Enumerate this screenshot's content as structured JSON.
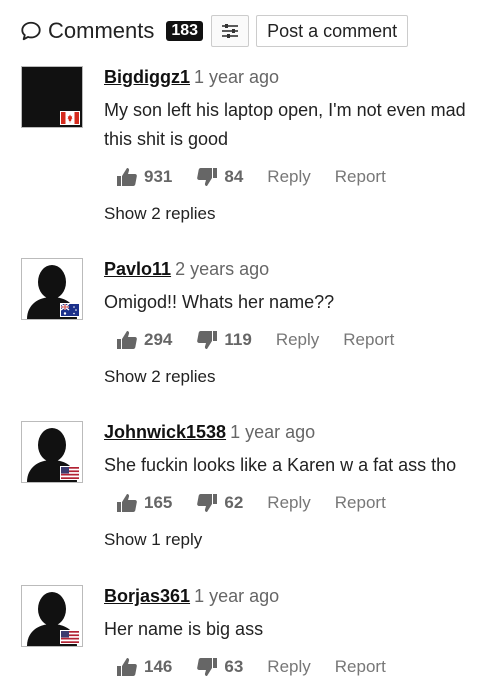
{
  "header": {
    "title": "Comments",
    "count": "183",
    "filter_icon": "sliders-icon",
    "post_label": "Post a comment"
  },
  "comments": [
    {
      "username": "Bigdiggz1",
      "ago": "1 year ago",
      "lines": [
        "My son left his laptop open, I'm not even mad",
        "this shit is good"
      ],
      "likes": "931",
      "dislikes": "84",
      "reply": "Reply",
      "report": "Report",
      "replies": "Show 2 replies",
      "flag": "canada-flag"
    },
    {
      "username": "Pavlo11",
      "ago": "2 years ago",
      "lines": [
        "Omigod!! Whats her name??"
      ],
      "likes": "294",
      "dislikes": "119",
      "reply": "Reply",
      "report": "Report",
      "replies": "Show 2 replies",
      "flag": "australia-flag"
    },
    {
      "username": "Johnwick1538",
      "ago": "1 year ago",
      "lines": [
        "She fuckin looks like a Karen w a fat ass tho"
      ],
      "likes": "165",
      "dislikes": "62",
      "reply": "Reply",
      "report": "Report",
      "replies": "Show 1 reply",
      "flag": "usa-flag"
    },
    {
      "username": "Borjas361",
      "ago": "1 year ago",
      "lines": [
        "Her name is big ass"
      ],
      "likes": "146",
      "dislikes": "63",
      "reply": "Reply",
      "report": "Report",
      "replies": "",
      "flag": "usa-flag"
    }
  ]
}
